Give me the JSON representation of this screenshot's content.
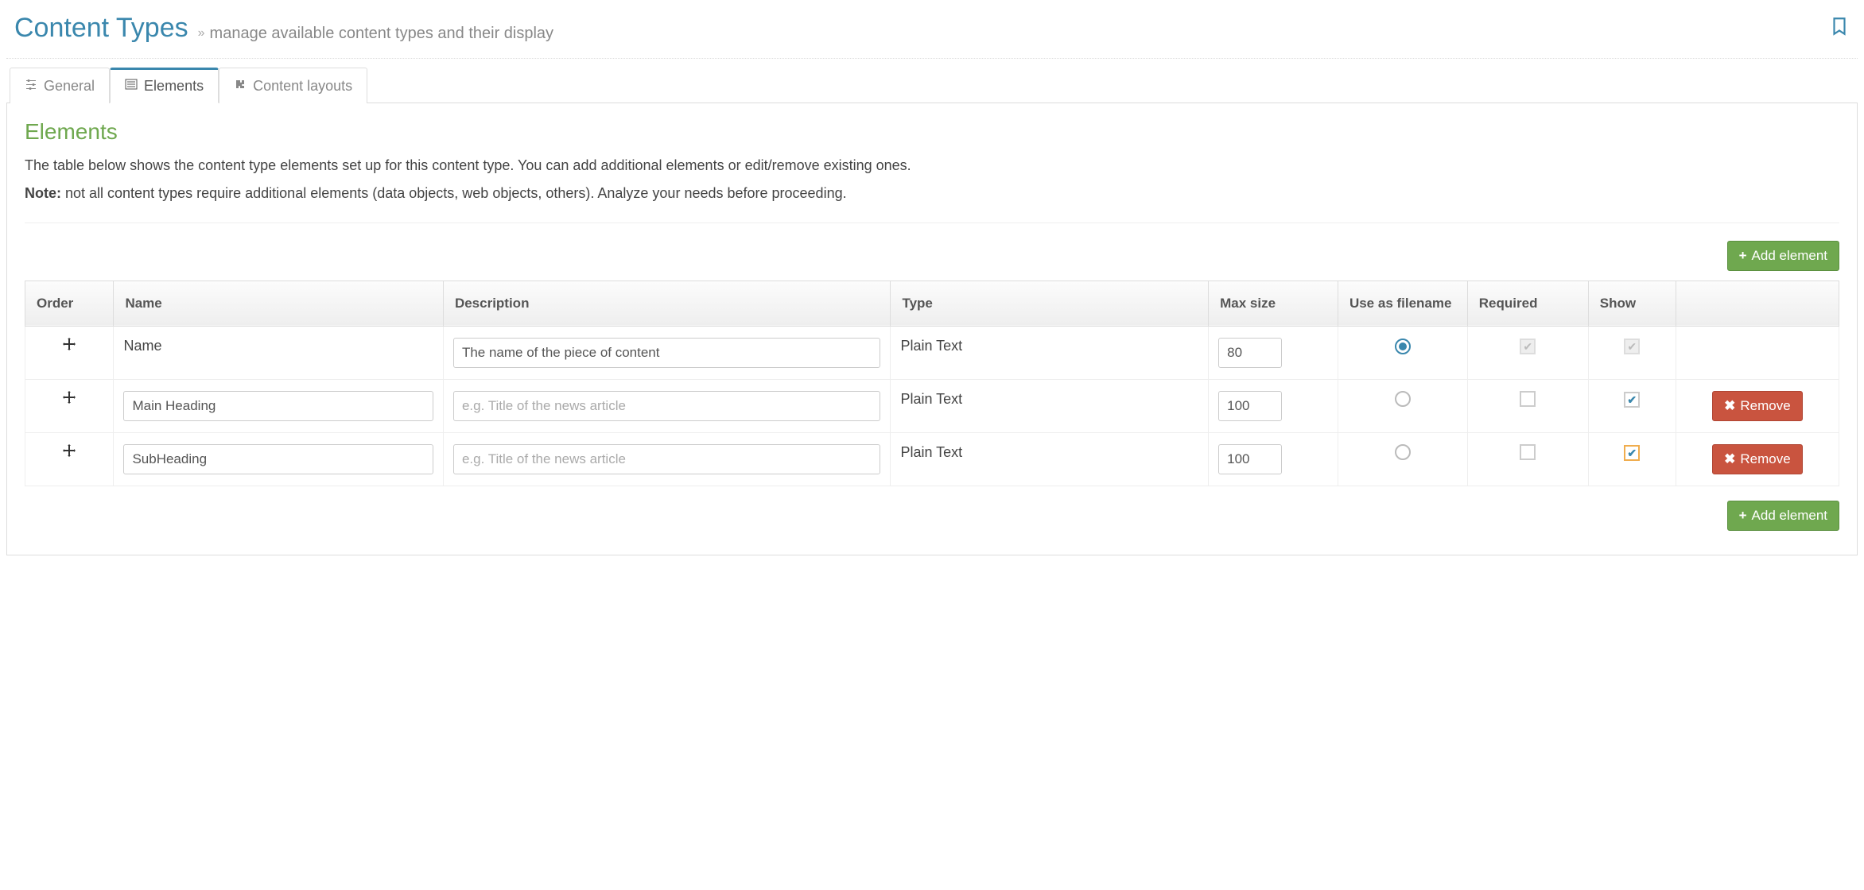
{
  "header": {
    "title": "Content Types",
    "subtitle": "manage available content types and their display"
  },
  "tabs": [
    {
      "label": "General",
      "icon": "sliders-icon",
      "active": false
    },
    {
      "label": "Elements",
      "icon": "list-icon",
      "active": true
    },
    {
      "label": "Content layouts",
      "icon": "puzzle-icon",
      "active": false
    }
  ],
  "section": {
    "title": "Elements",
    "intro_line1": "The table below shows the content type elements set up for this content type. You can add additional elements or edit/remove existing ones.",
    "note_label": "Note:",
    "intro_line2": " not all content types require additional elements (data objects, web objects, others). Analyze your needs before proceeding."
  },
  "buttons": {
    "add_element": "Add element",
    "remove": "Remove"
  },
  "table": {
    "headers": {
      "order": "Order",
      "name": "Name",
      "description": "Description",
      "type": "Type",
      "max_size": "Max size",
      "use_as_filename": "Use as filename",
      "required": "Required",
      "show": "Show"
    },
    "rows": [
      {
        "name_static": "Name",
        "name_value": "",
        "name_is_input": false,
        "description_value": "The name of the piece of content",
        "description_placeholder": "",
        "type": "Plain Text",
        "max_size": "80",
        "use_as_filename": true,
        "required_checked": true,
        "required_disabled": true,
        "show_checked": true,
        "show_disabled": true,
        "show_focused": false,
        "removable": false
      },
      {
        "name_static": "",
        "name_value": "Main Heading",
        "name_is_input": true,
        "description_value": "",
        "description_placeholder": "e.g. Title of the news article",
        "type": "Plain Text",
        "max_size": "100",
        "use_as_filename": false,
        "required_checked": false,
        "required_disabled": false,
        "show_checked": true,
        "show_disabled": false,
        "show_focused": false,
        "removable": true
      },
      {
        "name_static": "",
        "name_value": "SubHeading",
        "name_is_input": true,
        "description_value": "",
        "description_placeholder": "e.g. Title of the news article",
        "type": "Plain Text",
        "max_size": "100",
        "use_as_filename": false,
        "required_checked": false,
        "required_disabled": false,
        "show_checked": true,
        "show_disabled": false,
        "show_focused": true,
        "removable": true
      }
    ]
  }
}
